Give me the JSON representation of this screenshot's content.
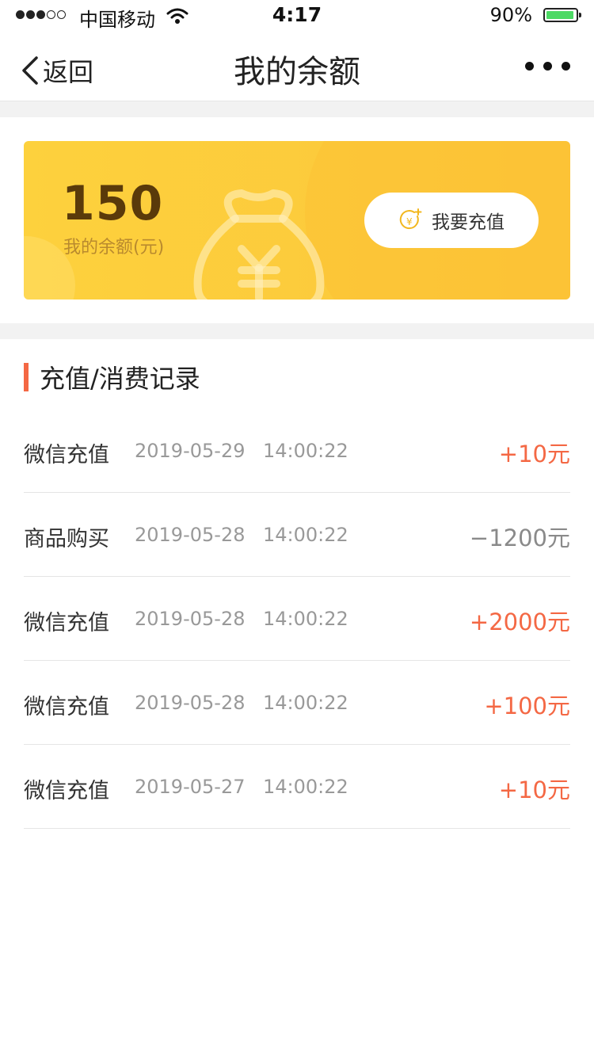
{
  "status_bar": {
    "carrier": "中国移动",
    "time": "4:17",
    "battery": "90%",
    "battery_level": 0.9,
    "signal_bars": 3
  },
  "nav": {
    "back_label": "返回",
    "title": "我的余额"
  },
  "balance": {
    "amount": "150",
    "label": "我的余额(元)",
    "recharge_label": "我要充值"
  },
  "records_section": {
    "title": "充值/消费记录",
    "items": [
      {
        "type": "微信充值",
        "date": "2019-05-29",
        "time": "14:00:22",
        "amount": "+10元",
        "kind": "pos"
      },
      {
        "type": "商品购买",
        "date": "2019-05-28",
        "time": "14:00:22",
        "amount": "−1200元",
        "kind": "neg"
      },
      {
        "type": "微信充值",
        "date": "2019-05-28",
        "time": "14:00:22",
        "amount": "+2000元",
        "kind": "pos"
      },
      {
        "type": "微信充值",
        "date": "2019-05-28",
        "time": "14:00:22",
        "amount": "+100元",
        "kind": "pos"
      },
      {
        "type": "微信充值",
        "date": "2019-05-27",
        "time": "14:00:22",
        "amount": "+10元",
        "kind": "pos"
      }
    ]
  },
  "colors": {
    "accent": "#f46844",
    "card": "#fdd13d",
    "amount_text": "#5a3a0a"
  }
}
